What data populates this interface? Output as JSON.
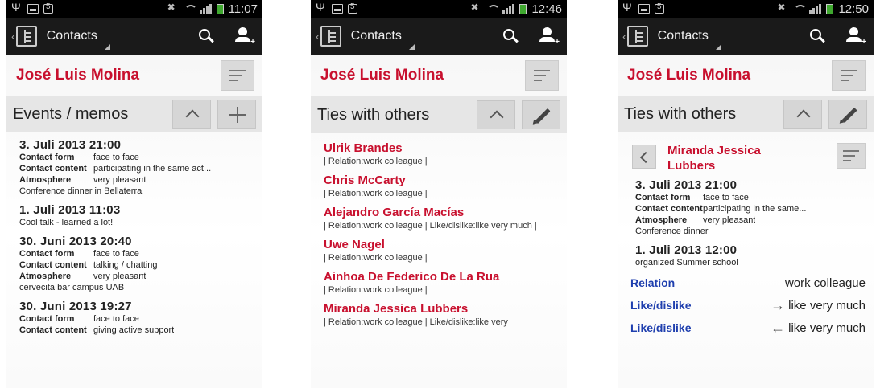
{
  "phones": [
    {
      "time": "11:07",
      "nav_title": "Contacts",
      "contact_name": "José Luis Molina",
      "section_title": "Events / memos",
      "events": [
        {
          "date": "3. Juli 2013  21:00",
          "rows": [
            {
              "label": "Contact form",
              "value": "face to face"
            },
            {
              "label": "Contact content",
              "value": "participating in the same act..."
            },
            {
              "label": "Atmosphere",
              "value": "very pleasant"
            }
          ],
          "note": "Conference dinner in Bellaterra"
        },
        {
          "date": "1. Juli 2013  11:03",
          "rows": [],
          "note": "Cool talk - learned a lot!"
        },
        {
          "date": "30. Juni 2013  20:40",
          "rows": [
            {
              "label": "Contact form",
              "value": "face to face"
            },
            {
              "label": "Contact content",
              "value": "talking / chatting"
            },
            {
              "label": "Atmosphere",
              "value": "very pleasant"
            }
          ],
          "note": "cervecita bar campus UAB"
        },
        {
          "date": "30. Juni 2013  19:27",
          "rows": [
            {
              "label": "Contact form",
              "value": "face to face"
            },
            {
              "label": "Contact content",
              "value": "giving active support"
            }
          ],
          "note": ""
        }
      ]
    },
    {
      "time": "12:46",
      "nav_title": "Contacts",
      "contact_name": "José Luis Molina",
      "section_title": "Ties with others",
      "ties": [
        {
          "name": "Ulrik Brandes",
          "relation": "| Relation:work colleague |"
        },
        {
          "name": "Chris McCarty",
          "relation": "| Relation:work colleague |"
        },
        {
          "name": "Alejandro García Macías",
          "relation": "| Relation:work colleague | Like/dislike:like very much |"
        },
        {
          "name": "Uwe Nagel",
          "relation": "| Relation:work colleague |"
        },
        {
          "name": "Ainhoa De Federico De La Rua",
          "relation": "| Relation:work colleague |"
        },
        {
          "name": "Miranda Jessica Lubbers",
          "relation": "| Relation:work colleague | Like/dislike:like very"
        }
      ]
    },
    {
      "time": "12:50",
      "nav_title": "Contacts",
      "contact_name": "José Luis Molina",
      "section_title": "Ties with others",
      "sub_name": "Miranda Jessica Lubbers",
      "events": [
        {
          "date": "3. Juli 2013  21:00",
          "rows": [
            {
              "label": "Contact form",
              "value": "face to face"
            },
            {
              "label": "Contact content",
              "value": "participating in the same..."
            },
            {
              "label": "Atmosphere",
              "value": "very pleasant"
            }
          ],
          "note": "Conference dinner"
        },
        {
          "date": "1. Juli 2013  12:00",
          "rows": [],
          "note": "organized Summer school"
        }
      ],
      "relations": [
        {
          "label": "Relation",
          "arrow": "",
          "value": "work colleague"
        },
        {
          "label": "Like/dislike",
          "arrow": "→",
          "value": "like very much"
        },
        {
          "label": "Like/dislike",
          "arrow": "←",
          "value": "like very much"
        }
      ]
    }
  ],
  "colors": {
    "name_red": "#c8102e",
    "relation_blue": "#1f3fae",
    "actionbar": "#1a1a1a",
    "battery_green": "#3fa82f"
  }
}
